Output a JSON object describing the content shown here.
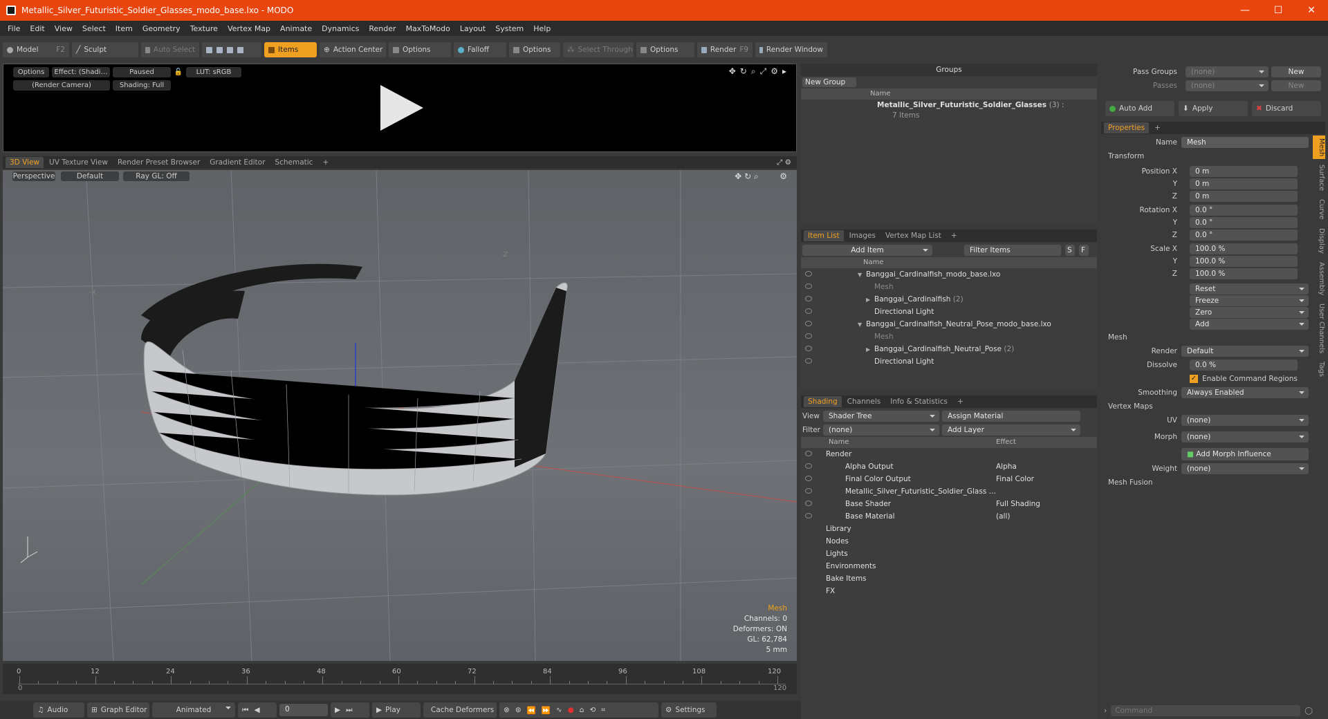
{
  "window": {
    "title": "Metallic_Silver_Futuristic_Soldier_Glasses_modo_base.lxo - MODO",
    "minimize": "—",
    "maximize": "☐",
    "close": "✕"
  },
  "menu": [
    "File",
    "Edit",
    "View",
    "Select",
    "Item",
    "Geometry",
    "Texture",
    "Vertex Map",
    "Animate",
    "Dynamics",
    "Render",
    "MaxToModo",
    "Layout",
    "System",
    "Help"
  ],
  "toolbar": {
    "model": "Model",
    "model_key": "F2",
    "sculpt": "Sculpt",
    "auto_select": "Auto Select",
    "items": "Items",
    "action_center": "Action Center",
    "options1": "Options",
    "falloff": "Falloff",
    "options2": "Options",
    "select_through": "Select Through",
    "options3": "Options",
    "render": "Render",
    "render_key": "F9",
    "render_window": "Render Window"
  },
  "preview": {
    "options": "Options",
    "effect": "Effect: (Shadi…",
    "paused": "Paused",
    "lut": "LUT: sRGB",
    "camera": "(Render Camera)",
    "shading": "Shading: Full"
  },
  "viewport_tabs": [
    "3D View",
    "UV Texture View",
    "Render Preset Browser",
    "Gradient Editor",
    "Schematic",
    "+"
  ],
  "viewport": {
    "perspective": "Perspective",
    "default": "Default",
    "raygl": "Ray GL: Off",
    "axis_label": "-Z",
    "axis_x": "-X"
  },
  "stats": {
    "mesh": "Mesh",
    "channels": "Channels: 0",
    "deformers": "Deformers: ON",
    "gl": "GL: 62,784",
    "size": "5 mm"
  },
  "timeline": {
    "ticks": [
      "0",
      "12",
      "24",
      "36",
      "48",
      "60",
      "72",
      "84",
      "96",
      "108",
      "120"
    ],
    "start": "0",
    "end": "120"
  },
  "bottom": {
    "audio": "Audio",
    "graph_editor": "Graph Editor",
    "animated": "Animated",
    "frame": "0",
    "play": "Play",
    "cache": "Cache Deformers",
    "settings": "Settings"
  },
  "groups": {
    "title": "Groups",
    "new_group": "New Group",
    "name_col": "Name",
    "item": "Metallic_Silver_Futuristic_Soldier_Glasses",
    "item_count": "(3) :",
    "item_sub": "7 Items"
  },
  "itemlist": {
    "tabs": [
      "Item List",
      "Images",
      "Vertex Map List",
      "+"
    ],
    "add_item": "Add Item",
    "filter": "Filter Items",
    "s": "S",
    "f": "F",
    "name_col": "Name",
    "rows": [
      {
        "label": "Banggai_Cardinalfish_modo_base.lxo",
        "indent": 0,
        "dim": false,
        "arrow": "▼"
      },
      {
        "label": "Mesh",
        "indent": 1,
        "dim": true,
        "arrow": ""
      },
      {
        "label": "Banggai_Cardinalfish",
        "indent": 1,
        "dim": false,
        "arrow": "▶",
        "suffix": "(2)"
      },
      {
        "label": "Directional Light",
        "indent": 1,
        "dim": false,
        "arrow": ""
      },
      {
        "label": "Banggai_Cardinalfish_Neutral_Pose_modo_base.lxo",
        "indent": 0,
        "dim": false,
        "arrow": "▼"
      },
      {
        "label": "Mesh",
        "indent": 1,
        "dim": true,
        "arrow": ""
      },
      {
        "label": "Banggai_Cardinalfish_Neutral_Pose",
        "indent": 1,
        "dim": false,
        "arrow": "▶",
        "suffix": "(2)"
      },
      {
        "label": "Directional Light",
        "indent": 1,
        "dim": false,
        "arrow": ""
      }
    ]
  },
  "shading": {
    "tabs": [
      "Shading",
      "Channels",
      "Info & Statistics",
      "+"
    ],
    "view_label": "View",
    "view_value": "Shader Tree",
    "assign": "Assign Material",
    "filter_label": "Filter",
    "filter_value": "(none)",
    "add_layer": "Add Layer",
    "name_col": "Name",
    "effect_col": "Effect",
    "rows": [
      {
        "name": "Render",
        "effect": "",
        "indent": 0
      },
      {
        "name": "Alpha Output",
        "effect": "Alpha",
        "indent": 1
      },
      {
        "name": "Final Color Output",
        "effect": "Final Color",
        "indent": 1
      },
      {
        "name": "Metallic_Silver_Futuristic_Soldier_Glass …",
        "effect": "",
        "indent": 1
      },
      {
        "name": "Base Shader",
        "effect": "Full Shading",
        "indent": 1
      },
      {
        "name": "Base Material",
        "effect": "(all)",
        "indent": 1
      },
      {
        "name": "Library",
        "effect": "",
        "indent": 0
      },
      {
        "name": "Nodes",
        "effect": "",
        "indent": 0
      },
      {
        "name": "Lights",
        "effect": "",
        "indent": 0
      },
      {
        "name": "Environments",
        "effect": "",
        "indent": 0
      },
      {
        "name": "Bake Items",
        "effect": "",
        "indent": 0
      },
      {
        "name": "FX",
        "effect": "",
        "indent": 0
      }
    ]
  },
  "passes": {
    "pass_groups": "Pass Groups",
    "passes": "Passes",
    "none1": "(none)",
    "none2": "(none)",
    "new": "New",
    "new2": "New",
    "auto_add": "Auto Add",
    "apply": "Apply",
    "discard": "Discard"
  },
  "properties": {
    "tab": "Properties",
    "plus": "+",
    "name_label": "Name",
    "name_value": "Mesh",
    "transform": "Transform",
    "pos_label": "Position X",
    "px": "0 m",
    "py": "0 m",
    "pz": "0 m",
    "rot_label": "Rotation X",
    "rx": "0.0 °",
    "ry": "0.0 °",
    "rz": "0.0 °",
    "scale_label": "Scale X",
    "sx": "100.0 %",
    "sy": "100.0 %",
    "sz": "100.0 %",
    "y": "Y",
    "z": "Z",
    "reset": "Reset",
    "freeze": "Freeze",
    "zero": "Zero",
    "add": "Add",
    "mesh": "Mesh",
    "render_label": "Render",
    "render_value": "Default",
    "dissolve_label": "Dissolve",
    "dissolve_value": "0.0 %",
    "enable_cmd": "Enable Command Regions",
    "smoothing_label": "Smoothing",
    "smoothing_value": "Always Enabled",
    "vertex_maps": "Vertex Maps",
    "uv_label": "UV",
    "uv_value": "(none)",
    "morph_label": "Morph",
    "morph_value": "(none)",
    "add_morph": "Add Morph Influence",
    "weight_label": "Weight",
    "weight_value": "(none)",
    "mesh_fusion": "Mesh Fusion"
  },
  "side_tabs": [
    "Mesh",
    "Surface",
    "Curve",
    "Display",
    "Assembly",
    "User Channels",
    "Tags"
  ],
  "command": {
    "placeholder": "Command"
  },
  "colors": {
    "accent": "#f0a020",
    "title": "#e8450f"
  }
}
